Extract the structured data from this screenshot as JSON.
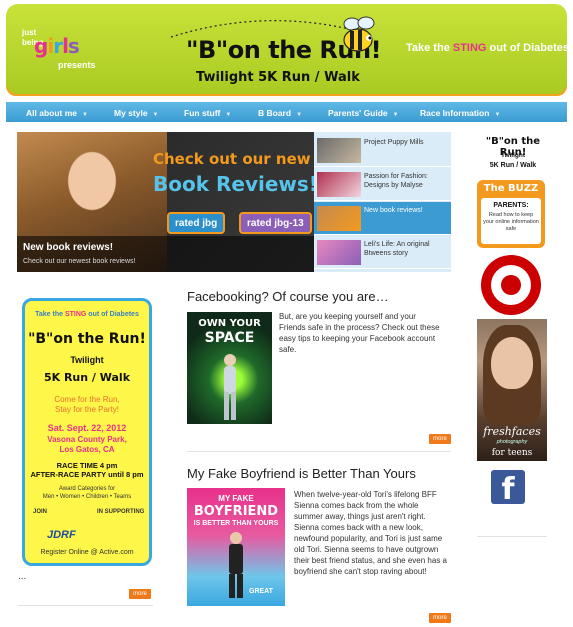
{
  "header": {
    "logo_just": "just",
    "logo_being": "being",
    "logo_girls": [
      "g",
      "i",
      "r",
      "l",
      "s"
    ],
    "logo_presents": "presents",
    "title": "\"B\"on the Run!",
    "subtitle": "Twilight 5K Run / Walk",
    "tagline_pre": "Take the ",
    "tagline_sting": "STING",
    "tagline_post": " out of Diabetes"
  },
  "nav": {
    "items": [
      {
        "label": "All about me"
      },
      {
        "label": "My style"
      },
      {
        "label": "Fun stuff"
      },
      {
        "label": "B Board"
      },
      {
        "label": "Parents' Guide"
      },
      {
        "label": "Race Information"
      }
    ]
  },
  "slider": {
    "headline1": "Check out our new",
    "headline2": "Book Reviews!",
    "badge1": "rated jbg",
    "badge2": "rated jbg-13",
    "caption_title": "New book reviews!",
    "caption_sub": "Check out our newest book reviews!",
    "list": [
      {
        "label": "Project Puppy Mills"
      },
      {
        "label": "Passion for Fashion: Designs by Malyse"
      },
      {
        "label": "New book reviews!"
      },
      {
        "label": "Leli's Life: An original Btweens story"
      }
    ]
  },
  "left_ad": {
    "tag_pre": "Take the ",
    "tag_sting": "STING",
    "tag_post": " out of Diabetes",
    "title": "\"B\"on the Run!",
    "twilight": "Twilight",
    "run": "5K Run / Walk",
    "come_line1": "Come for the Run,",
    "come_line2": "Stay for the Party!",
    "date": "Sat. Sept. 22, 2012",
    "venue_line1": "Vasona County Park,",
    "venue_line2": "Los Gatos, CA",
    "race_line1": "RACE TIME 4 pm",
    "race_line2": "AFTER-RACE PARTY until 8 pm",
    "award_line1": "Award Categories for",
    "award_line2": "Men • Women • Children • Teams",
    "join": "JOIN",
    "support": "IN SUPPORTING",
    "jdrf": "JDRF",
    "register": "Register Online @ Active.com"
  },
  "left_dots": "...",
  "more_label": "more",
  "articles": [
    {
      "title": "Facebooking? Of course you are…",
      "image_text_line1": "OWN YOUR",
      "image_text_line2": "SPACE",
      "body": "But, are you keeping yourself and your Friends safe in the process? Check out these easy tips to keeping your Facebook account safe."
    },
    {
      "title": "My Fake Boyfriend is Better Than Yours",
      "image_text_line1": "MY FAKE",
      "image_text_line2": "BOYFRIEND",
      "image_text_line3": "IS BETTER THAN YOURS",
      "image_text_line4": "GREAT",
      "body": "When twelve-year-old Tori's lifelong BFF Sienna comes back from the whole summer away, things just aren't right. Sienna comes back with a new look, newfound popularity, and Tori is just same old Tori. Sienna seems to have outgrown their best friend status, and she even has a boyfriend she can't stop raving about!"
    }
  ],
  "right": {
    "logo_title": "\"B\"on the Run!",
    "logo_twilight": "Twilight",
    "logo_run": "5K Run / Walk",
    "buzz_title": "The BUZZ",
    "buzz_parents": "PARENTS:",
    "buzz_text": "Read how to keep your online information safe",
    "fresh_title": "freshfaces",
    "fresh_sub": "photography",
    "fresh_teens": "for teens",
    "fb_letter": "f"
  },
  "colors": {
    "header_green": "#b5d22c",
    "header_orange": "#f0a21e",
    "nav_blue": "#3b9bd2",
    "more_orange": "#f07a1a",
    "facebook_blue": "#3b5998",
    "target_red": "#cc0000"
  }
}
